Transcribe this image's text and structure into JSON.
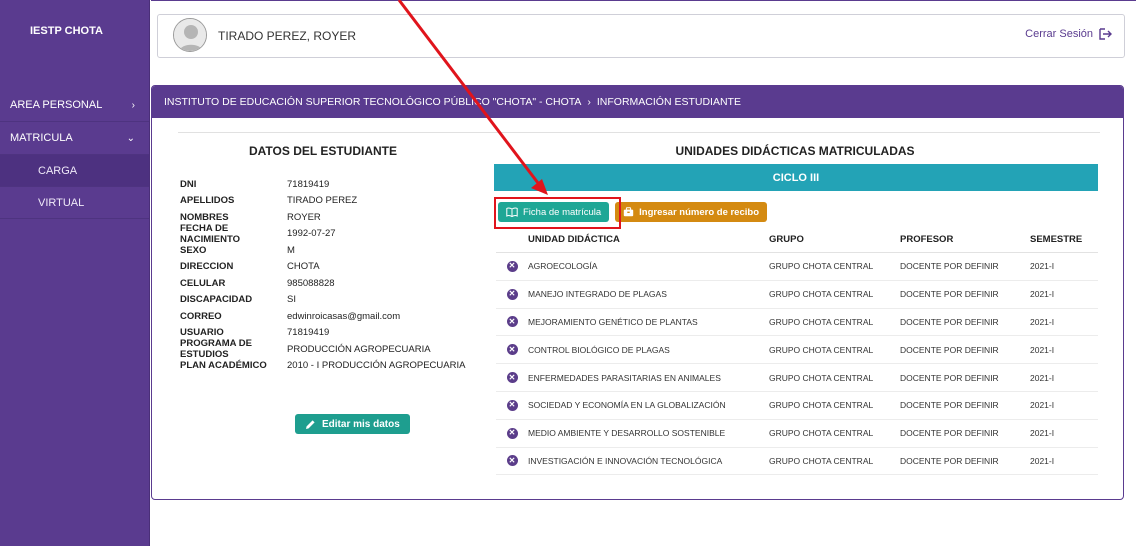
{
  "sidebar": {
    "brand": "IESTP CHOTA",
    "items": [
      {
        "label": "AREA PERSONAL",
        "chevron": "›"
      },
      {
        "label": "MATRICULA",
        "chevron": "⌄"
      }
    ],
    "subitems": [
      {
        "label": "CARGA"
      },
      {
        "label": "VIRTUAL"
      }
    ]
  },
  "header": {
    "user_name": "TIRADO PEREZ, ROYER",
    "logout_label": "Cerrar Sesión"
  },
  "breadcrumb": {
    "root": "INSTITUTO DE EDUCACIÓN SUPERIOR TECNOLÓGICO PÚBLICO \"CHOTA\" - CHOTA",
    "separator": "›",
    "current": "INFORMACIÓN ESTUDIANTE"
  },
  "student": {
    "title": "DATOS DEL ESTUDIANTE",
    "fields": [
      {
        "label": "DNI",
        "value": "71819419"
      },
      {
        "label": "APELLIDOS",
        "value": "TIRADO PEREZ"
      },
      {
        "label": "NOMBRES",
        "value": "ROYER"
      },
      {
        "label": "FECHA DE NACIMIENTO",
        "value": "1992-07-27"
      },
      {
        "label": "SEXO",
        "value": "M"
      },
      {
        "label": "DIRECCION",
        "value": "CHOTA"
      },
      {
        "label": "CELULAR",
        "value": "985088828"
      },
      {
        "label": "DISCAPACIDAD",
        "value": "SI"
      },
      {
        "label": "CORREO",
        "value": "edwinroicasas@gmail.com"
      },
      {
        "label": "USUARIO",
        "value": "71819419"
      },
      {
        "label": "PROGRAMA DE ESTUDIOS",
        "value": "PRODUCCIÓN AGROPECUARIA"
      },
      {
        "label": "PLAN ACADÉMICO",
        "value": "2010 - I PRODUCCIÓN AGROPECUARIA"
      }
    ],
    "edit_label": "Editar mis datos"
  },
  "units": {
    "title": "UNIDADES DIDÁCTICAS MATRICULADAS",
    "cycle": "CICLO III",
    "ficha_label": "Ficha de matrícula",
    "recibo_label": "Ingresar número de recibo",
    "columns": {
      "unidad": "UNIDAD DIDÁCTICA",
      "grupo": "GRUPO",
      "profesor": "PROFESOR",
      "semestre": "SEMESTRE"
    },
    "rows": [
      {
        "unidad": "AGROECOLOGÍA",
        "grupo": "GRUPO CHOTA CENTRAL",
        "profesor": "DOCENTE POR DEFINIR",
        "semestre": "2021-I"
      },
      {
        "unidad": "MANEJO INTEGRADO DE PLAGAS",
        "grupo": "GRUPO CHOTA CENTRAL",
        "profesor": "DOCENTE POR DEFINIR",
        "semestre": "2021-I"
      },
      {
        "unidad": "MEJORAMIENTO GENÉTICO DE PLANTAS",
        "grupo": "GRUPO CHOTA CENTRAL",
        "profesor": "DOCENTE POR DEFINIR",
        "semestre": "2021-I"
      },
      {
        "unidad": "CONTROL BIOLÓGICO DE PLAGAS",
        "grupo": "GRUPO CHOTA CENTRAL",
        "profesor": "DOCENTE POR DEFINIR",
        "semestre": "2021-I"
      },
      {
        "unidad": "ENFERMEDADES PARASITARIAS EN ANIMALES",
        "grupo": "GRUPO CHOTA CENTRAL",
        "profesor": "DOCENTE POR DEFINIR",
        "semestre": "2021-I"
      },
      {
        "unidad": "SOCIEDAD Y ECONOMÍA EN LA GLOBALIZACIÓN",
        "grupo": "GRUPO CHOTA CENTRAL",
        "profesor": "DOCENTE POR DEFINIR",
        "semestre": "2021-I"
      },
      {
        "unidad": "MEDIO AMBIENTE Y DESARROLLO SOSTENIBLE",
        "grupo": "GRUPO CHOTA CENTRAL",
        "profesor": "DOCENTE POR DEFINIR",
        "semestre": "2021-I"
      },
      {
        "unidad": "INVESTIGACIÓN E INNOVACIÓN TECNOLÓGICA",
        "grupo": "GRUPO CHOTA CENTRAL",
        "profesor": "DOCENTE POR DEFINIR",
        "semestre": "2021-I"
      }
    ]
  },
  "colors": {
    "purple": "#5a3b8f",
    "teal": "#1fa796",
    "cyan": "#23a3b6",
    "orange": "#d48a11",
    "highlight_red": "#e0141c"
  }
}
